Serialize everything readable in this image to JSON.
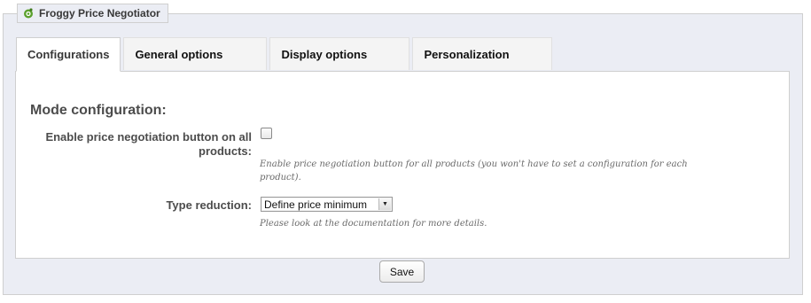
{
  "legend": {
    "title": "Froggy Price Negotiator",
    "icon": "froggy-logo-icon"
  },
  "tabs": [
    {
      "label": "Configurations",
      "active": true
    },
    {
      "label": "General options",
      "active": false
    },
    {
      "label": "Display options",
      "active": false
    },
    {
      "label": "Personalization",
      "active": false
    }
  ],
  "panel": {
    "section_title": "Mode configuration:",
    "enable_negotiation": {
      "label": "Enable price negotiation button on all products:",
      "checked": false,
      "hint": "Enable price negotiation button for all products (you won't have to set a configuration for each product)."
    },
    "type_reduction": {
      "label": "Type reduction:",
      "selected": "Define price minimum",
      "hint": "Please look at the documentation for more details."
    }
  },
  "footer": {
    "save_label": "Save"
  },
  "colors": {
    "panel_bg": "#ffffff",
    "frame_bg": "#ebedf4",
    "border": "#cfcfcf",
    "icon_green": "#5aa02c"
  }
}
